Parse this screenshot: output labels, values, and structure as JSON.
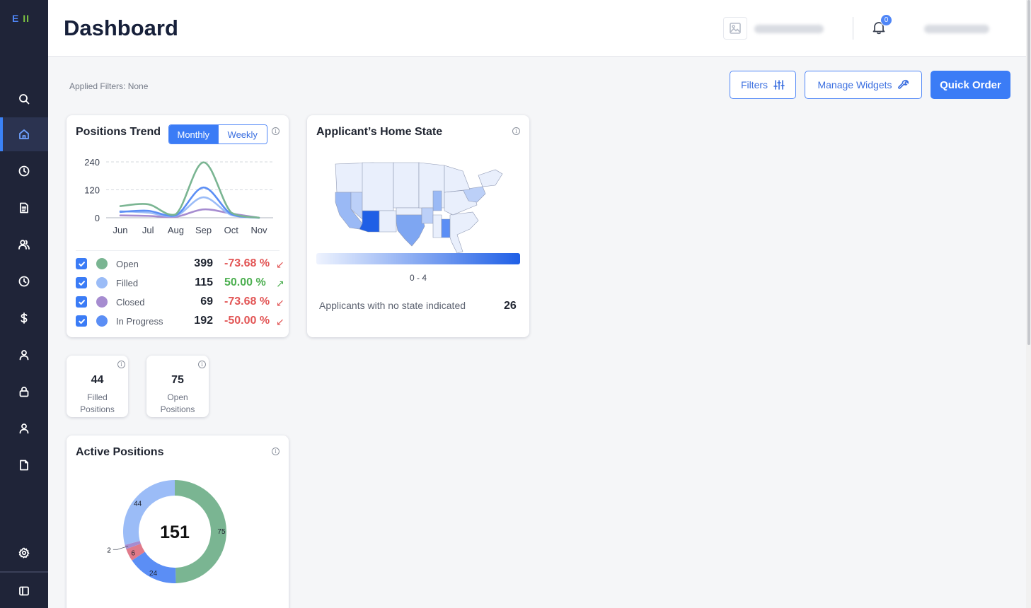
{
  "brand": {
    "logo_e": "E",
    "logo_ii": "II"
  },
  "sidebar": {
    "items": [
      {
        "name": "search",
        "icon": "search-icon"
      },
      {
        "name": "home",
        "icon": "home-icon",
        "active": true
      },
      {
        "name": "history",
        "icon": "clock-icon"
      },
      {
        "name": "documents",
        "icon": "document-icon"
      },
      {
        "name": "users",
        "icon": "users-icon"
      },
      {
        "name": "timesheets",
        "icon": "clock-icon"
      },
      {
        "name": "billing",
        "icon": "dollar-icon"
      },
      {
        "name": "profile",
        "icon": "user-icon"
      },
      {
        "name": "security",
        "icon": "lock-icon"
      },
      {
        "name": "account",
        "icon": "user-icon"
      },
      {
        "name": "files",
        "icon": "file-icon"
      },
      {
        "name": "settings",
        "icon": "gear-icon"
      },
      {
        "name": "collapse",
        "icon": "sidebar-toggle-icon"
      }
    ]
  },
  "header": {
    "title": "Dashboard",
    "notifications_count": "0"
  },
  "toolbar": {
    "applied_filters": "Applied Filters: None",
    "filters_label": "Filters",
    "manage_widgets_label": "Manage Widgets",
    "quick_order_label": "Quick Order"
  },
  "positions_trend": {
    "title": "Positions Trend",
    "toggle": {
      "monthly": "Monthly",
      "weekly": "Weekly",
      "selected": "Monthly"
    },
    "legend": [
      {
        "label": "Open",
        "value": "399",
        "change": "-73.68 %",
        "direction": "down",
        "color": "#7ab592"
      },
      {
        "label": "Filled",
        "value": "115",
        "change": "50.00 %",
        "direction": "up",
        "color": "#9bbcf7"
      },
      {
        "label": "Closed",
        "value": "69",
        "change": "-73.68 %",
        "direction": "down",
        "color": "#a68cd0"
      },
      {
        "label": "In Progress",
        "value": "192",
        "change": "-50.00 %",
        "direction": "down",
        "color": "#5b8ef5"
      }
    ],
    "colors": {
      "down": "#e25555",
      "up": "#4caf50"
    }
  },
  "chart_data": [
    {
      "type": "line",
      "x": [
        "Jun",
        "Jul",
        "Aug",
        "Sep",
        "Oct",
        "Nov"
      ],
      "yticks": [
        0,
        120,
        240
      ],
      "ylim": [
        0,
        240
      ],
      "grid": true,
      "series": [
        {
          "name": "Open",
          "color": "#7ab592",
          "values": [
            50,
            58,
            15,
            238,
            22,
            0
          ]
        },
        {
          "name": "Filled",
          "color": "#9bbcf7",
          "values": [
            28,
            22,
            8,
            88,
            12,
            0
          ]
        },
        {
          "name": "Closed",
          "color": "#a68cd0",
          "values": [
            10,
            8,
            4,
            36,
            18,
            0
          ]
        },
        {
          "name": "In Progress",
          "color": "#5b8ef5",
          "values": [
            25,
            30,
            10,
            130,
            16,
            0
          ]
        }
      ]
    },
    {
      "type": "pie",
      "center_value": "151",
      "slices": [
        {
          "value": 75,
          "color": "#7ab592"
        },
        {
          "value": 24,
          "color": "#5b8ef5"
        },
        {
          "value": 6,
          "color": "#e07a8a"
        },
        {
          "value": 2,
          "color": "#a68cd0"
        },
        {
          "value": 44,
          "color": "#9bbcf7"
        }
      ]
    }
  ],
  "home_state": {
    "title": "Applicant’s Home State",
    "range_label": "0 - 4",
    "no_state_label": "Applicants with no state indicated",
    "no_state_value": "26"
  },
  "stats": [
    {
      "value": "44",
      "label_line1": "Filled",
      "label_line2": "Positions"
    },
    {
      "value": "75",
      "label_line1": "Open",
      "label_line2": "Positions"
    }
  ],
  "active_positions": {
    "title": "Active Positions"
  }
}
